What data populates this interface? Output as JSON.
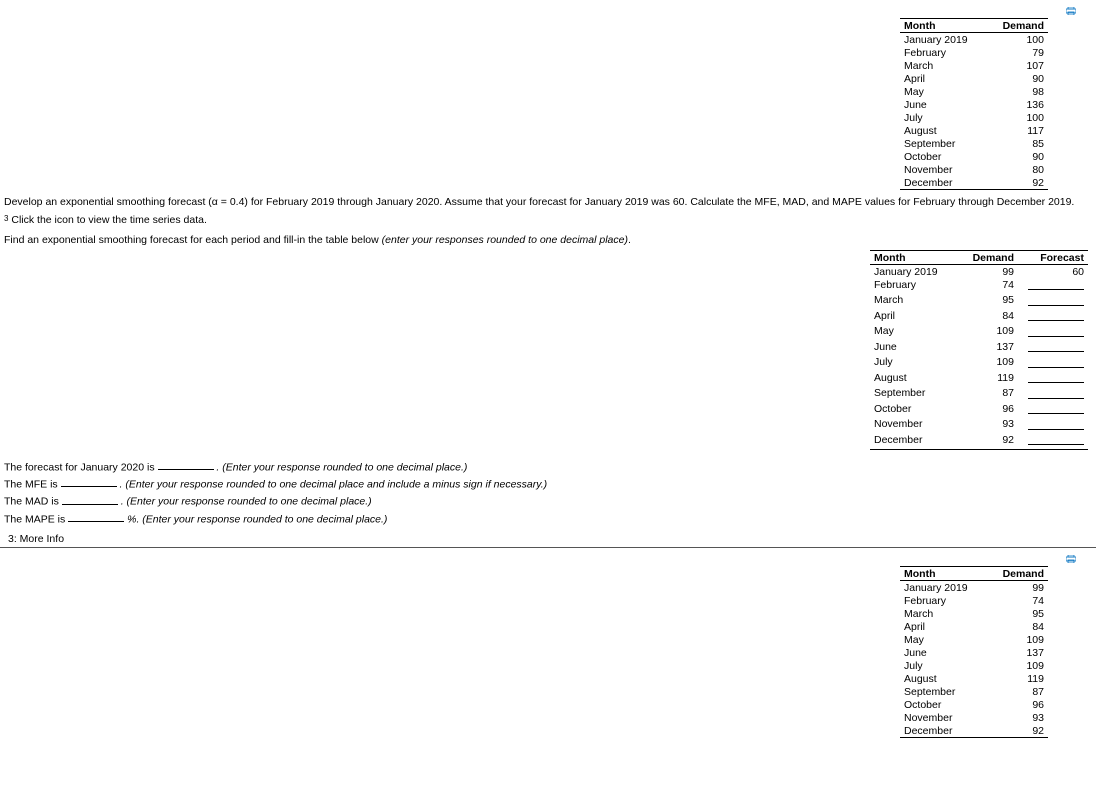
{
  "top_table": {
    "headers": [
      "Month",
      "Demand"
    ],
    "rows": [
      {
        "month": "January 2019",
        "demand": 100
      },
      {
        "month": "February",
        "demand": 79
      },
      {
        "month": "March",
        "demand": 107
      },
      {
        "month": "April",
        "demand": 90
      },
      {
        "month": "May",
        "demand": 98
      },
      {
        "month": "June",
        "demand": 136
      },
      {
        "month": "July",
        "demand": 100
      },
      {
        "month": "August",
        "demand": 117
      },
      {
        "month": "September",
        "demand": 85
      },
      {
        "month": "October",
        "demand": 90
      },
      {
        "month": "November",
        "demand": 80
      },
      {
        "month": "December",
        "demand": 92
      }
    ]
  },
  "problem_text": "Develop an exponential smoothing forecast (α = 0.4) for February 2019 through January 2020. Assume that your forecast for January 2019 was 60. Calculate the MFE, MAD, and MAPE values for February through December 2019.",
  "click_hint_prefix": "3",
  "click_hint": " Click the icon to view the time series data.",
  "fill_in_prefix": "Find an exponential smoothing forecast for each period and fill-in the table below ",
  "fill_in_italic": "(enter your responses rounded to one decimal place)",
  "forecast_table": {
    "headers": [
      "Month",
      "Demand",
      "Forecast"
    ],
    "rows": [
      {
        "month": "January 2019",
        "demand": 99,
        "forecast": "60"
      },
      {
        "month": "February",
        "demand": 74,
        "forecast": ""
      },
      {
        "month": "March",
        "demand": 95,
        "forecast": ""
      },
      {
        "month": "April",
        "demand": 84,
        "forecast": ""
      },
      {
        "month": "May",
        "demand": 109,
        "forecast": ""
      },
      {
        "month": "June",
        "demand": 137,
        "forecast": ""
      },
      {
        "month": "July",
        "demand": 109,
        "forecast": ""
      },
      {
        "month": "August",
        "demand": 119,
        "forecast": ""
      },
      {
        "month": "September",
        "demand": 87,
        "forecast": ""
      },
      {
        "month": "October",
        "demand": 96,
        "forecast": ""
      },
      {
        "month": "November",
        "demand": 93,
        "forecast": ""
      },
      {
        "month": "December",
        "demand": 92,
        "forecast": ""
      }
    ]
  },
  "prompts": {
    "jan2020_pre": "The forecast for January 2020 is ",
    "jan2020_post": ". (Enter your response rounded to one decimal place.)",
    "mfe_pre": "The MFE is ",
    "mfe_post": ". (Enter your response rounded to one decimal place and include a minus sign if necessary.)",
    "mad_pre": "The MAD is ",
    "mad_post": ". (Enter your response rounded to one decimal place.)",
    "mape_pre": "The MAPE is ",
    "mape_post": "%. (Enter your response rounded to one decimal place.)"
  },
  "more_info_label": "3: More Info",
  "bottom_table": {
    "headers": [
      "Month",
      "Demand"
    ],
    "rows": [
      {
        "month": "January 2019",
        "demand": 99
      },
      {
        "month": "February",
        "demand": 74
      },
      {
        "month": "March",
        "demand": 95
      },
      {
        "month": "April",
        "demand": 84
      },
      {
        "month": "May",
        "demand": 109
      },
      {
        "month": "June",
        "demand": 137
      },
      {
        "month": "July",
        "demand": 109
      },
      {
        "month": "August",
        "demand": 119
      },
      {
        "month": "September",
        "demand": 87
      },
      {
        "month": "October",
        "demand": 96
      },
      {
        "month": "November",
        "demand": 93
      },
      {
        "month": "December",
        "demand": 92
      }
    ]
  }
}
